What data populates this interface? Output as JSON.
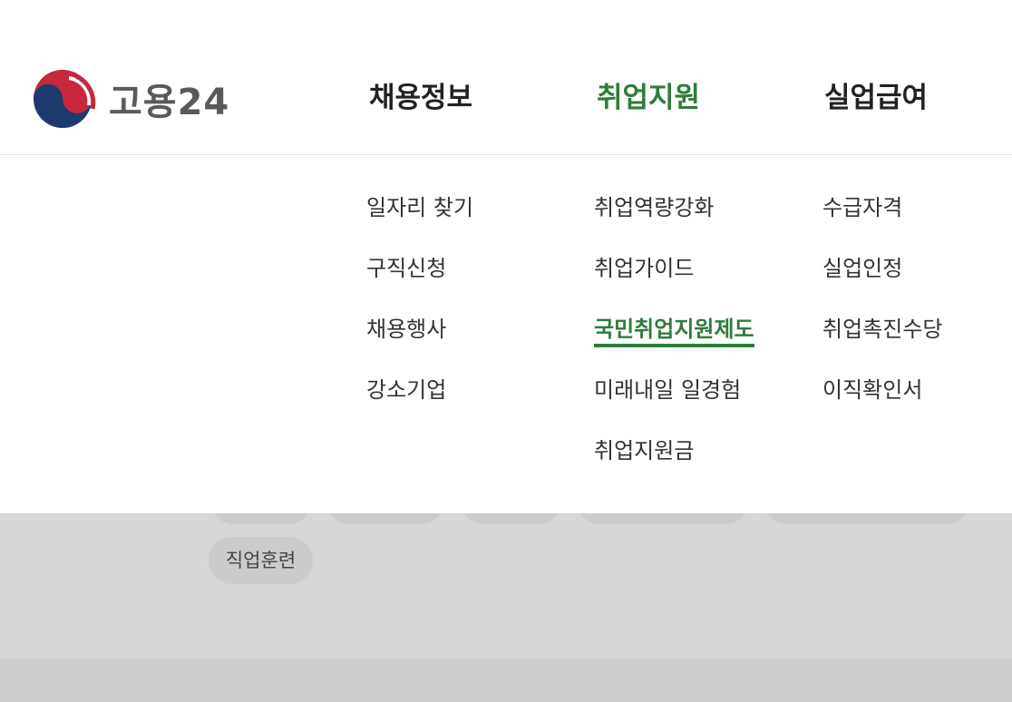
{
  "brand": {
    "logo_text": "고용24",
    "emblem_icon": "taegeuk-emblem-icon",
    "colors": {
      "red": "#c7283a",
      "blue": "#1b3a6e",
      "text": "#5a5a5a"
    }
  },
  "gnb": {
    "items": [
      {
        "label": "채용정보",
        "active": false
      },
      {
        "label": "취업지원",
        "active": true
      },
      {
        "label": "실업급여",
        "active": false
      }
    ],
    "accent_color": "#2e7d3a"
  },
  "dropdown": {
    "columns": [
      {
        "items": [
          "일자리 찾기",
          "구직신청",
          "채용행사",
          "강소기업"
        ]
      },
      {
        "items": [
          "취업역량강화",
          "취업가이드",
          "국민취업지원제도",
          "미래내일 일경험",
          "취업지원금"
        ],
        "current": "국민취업지원제도"
      },
      {
        "items": [
          "수급자격",
          "실업인정",
          "취업촉진수당",
          "이직확인서"
        ]
      }
    ]
  },
  "background": {
    "tag_label": "직업훈련"
  }
}
